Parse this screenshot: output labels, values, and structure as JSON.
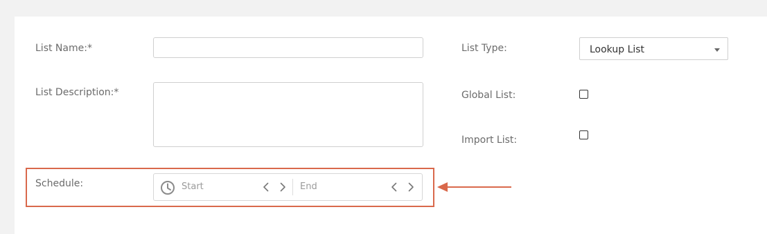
{
  "form": {
    "list_name_label": "List Name:*",
    "list_name_value": "",
    "list_description_label": "List Description:*",
    "list_description_value": "",
    "schedule_label": "Schedule:",
    "schedule_start_placeholder": "Start",
    "schedule_end_placeholder": "End",
    "list_type_label": "List Type:",
    "list_type_value": "Lookup List",
    "global_list_label": "Global List:",
    "global_list_checked": false,
    "import_list_label": "Import List:",
    "import_list_checked": false
  },
  "colors": {
    "highlight": "#d9684b",
    "panel_background": "#ffffff",
    "page_background": "#f2f2f2"
  },
  "icons": {
    "schedule": "clock-icon",
    "previous": "chevron-left-icon",
    "next": "chevron-right-icon",
    "dropdown": "caret-down-icon",
    "annotation": "arrow-left-icon"
  }
}
